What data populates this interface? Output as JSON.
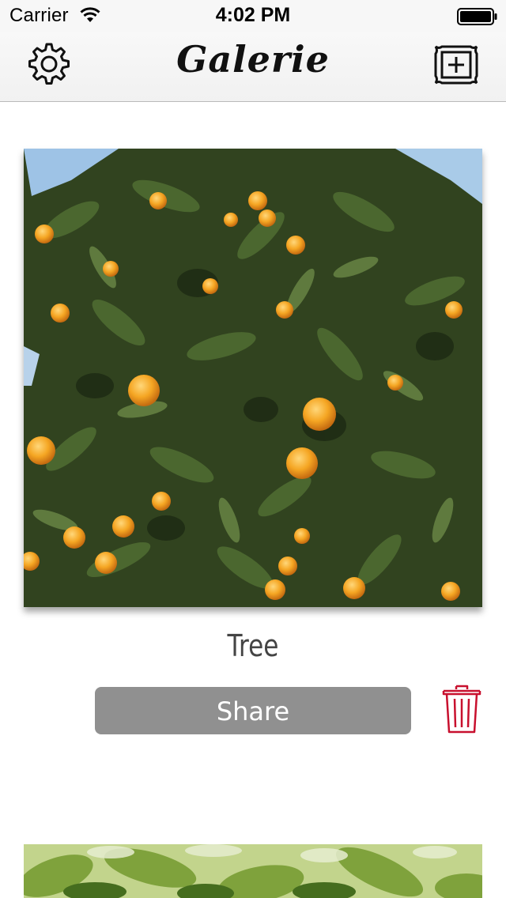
{
  "status_bar": {
    "carrier": "Carrier",
    "time": "4:02 PM",
    "wifi_icon": "wifi-icon",
    "battery_icon": "battery-icon"
  },
  "nav": {
    "title": "Galerie",
    "left_icon": "gear-icon",
    "right_icon": "add-picture-frame-icon"
  },
  "gallery": {
    "items": [
      {
        "caption": "Tree",
        "share_label": "Share",
        "delete_icon": "trash-icon",
        "image": "orange-tree-photo"
      },
      {
        "image": "green-leaves-photo"
      }
    ]
  },
  "colors": {
    "trash": "#c8102e",
    "share_button": "#909090",
    "caption": "#444444"
  }
}
